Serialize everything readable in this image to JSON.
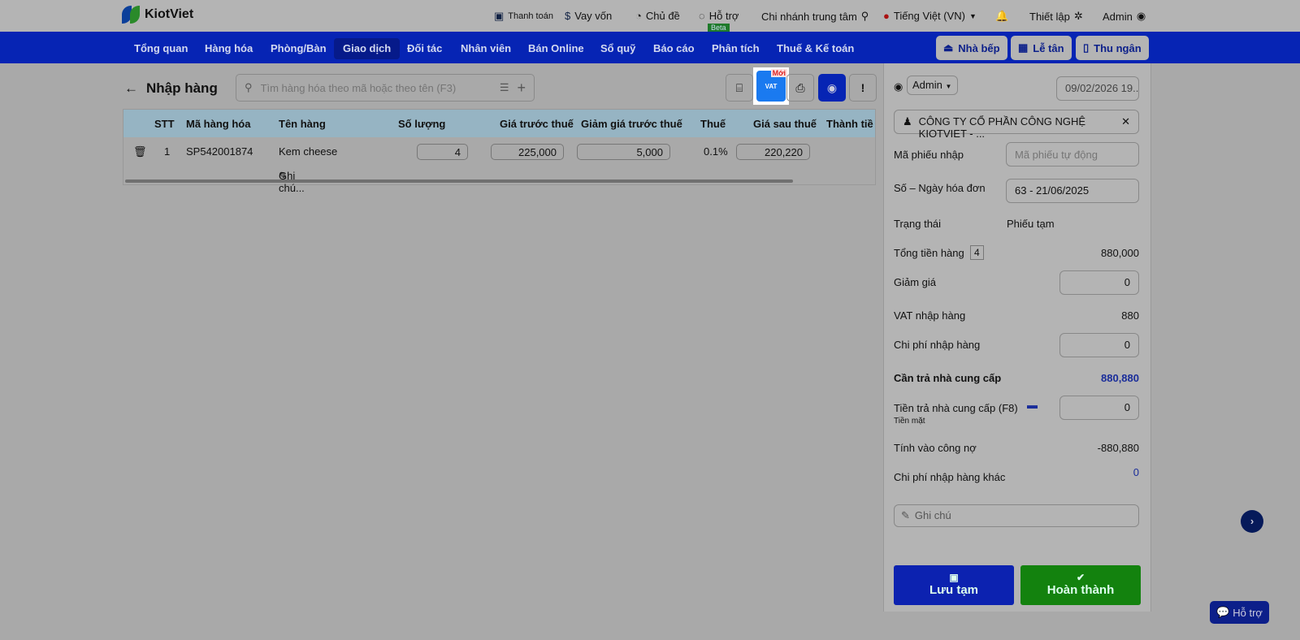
{
  "brand": "KiotViet",
  "topbar": {
    "payment": "Thanh toán",
    "loan": "Vay vốn",
    "theme": "Chủ đề",
    "support": "Hỗ trợ",
    "beta": "Beta",
    "branch": "Chi nhánh trung tâm",
    "language": "Tiếng Việt (VN)",
    "settings": "Thiết lập",
    "user": "Admin"
  },
  "nav": {
    "items": [
      "Tổng quan",
      "Hàng hóa",
      "Phòng/Bàn",
      "Giao dịch",
      "Đối tác",
      "Nhân viên",
      "Bán Online",
      "Sổ quỹ",
      "Báo cáo",
      "Phân tích",
      "Thuế & Kế toán"
    ],
    "kitchen": "Nhà bếp",
    "reception": "Lễ tân",
    "cashier": "Thu ngân"
  },
  "page": {
    "title": "Nhập hàng",
    "search_placeholder": "Tìm hàng hóa theo mã hoặc theo tên (F3)",
    "vat_label": "VAT",
    "new_badge": "Mới"
  },
  "table": {
    "headers": [
      "STT",
      "Mã hàng hóa",
      "Tên hàng",
      "Số lượng",
      "Giá trước thuế",
      "Giảm giá trước thuế",
      "Thuế",
      "Giá sau thuế",
      "Thành tiền"
    ],
    "rows": [
      {
        "stt": "1",
        "code": "SP542001874",
        "name": "Kem cheese",
        "note": "Ghi chú...",
        "qty": "4",
        "price": "225,000",
        "discount": "5,000",
        "tax": "0.1%",
        "after_tax": "220,220"
      }
    ]
  },
  "panel": {
    "staff": "Admin",
    "datetime": "09/02/2026 19...",
    "supplier": "CÔNG TY CỔ PHẦN CÔNG NGHỆ KIOTVIET - ...",
    "receipt_code_label": "Mã phiếu nhập",
    "receipt_code_placeholder": "Mã phiếu tự động",
    "invoice_label": "Số – Ngày hóa đơn",
    "invoice_value": "63 - 21/06/2025",
    "status_label": "Trạng thái",
    "status_value": "Phiếu tạm",
    "total_label": "Tổng tiền hàng",
    "total_count": "4",
    "total_value": "880,000",
    "discount_label": "Giảm giá",
    "discount_value": "0",
    "vat_label": "VAT nhập hàng",
    "vat_value": "880",
    "cost_label": "Chi phí nhập hàng",
    "cost_value": "0",
    "payable_label": "Cần trả nhà cung cấp",
    "payable_value": "880,880",
    "paid_label": "Tiền trả nhà cung cấp (F8)",
    "paid_method": "Tiền mặt",
    "paid_value": "0",
    "debt_label": "Tính vào công nợ",
    "debt_value": "-880,880",
    "other_cost_label": "Chi phí nhập hàng khác",
    "other_cost_value": "0",
    "note_placeholder": "Ghi chú",
    "save_draft": "Lưu tạm",
    "complete": "Hoàn thành"
  },
  "help_button": "Hỗ trợ"
}
